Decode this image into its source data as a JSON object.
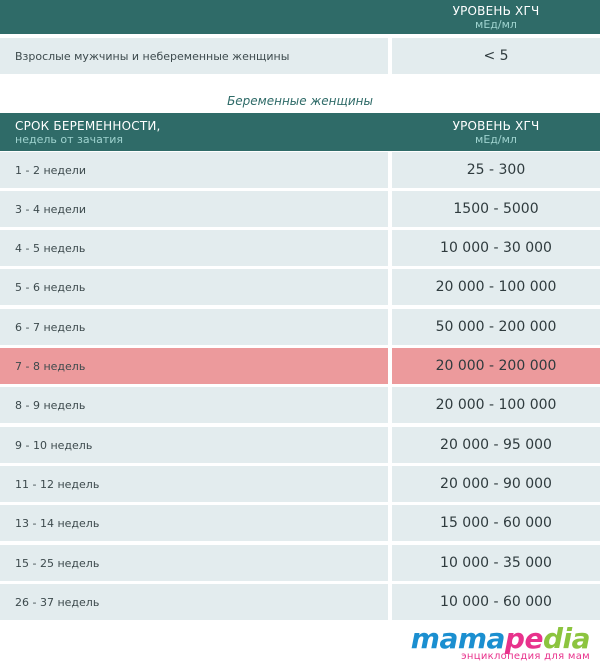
{
  "top_header": {
    "level_title": "УРОВЕНЬ ХГЧ",
    "level_unit": "мЕд/мл"
  },
  "non_pregnant": {
    "label": "Взрослые мужчины и небеременные женщины",
    "value": "< 5"
  },
  "section_title": "Беременные женщины",
  "table_header": {
    "term_title": "СРОК БЕРЕМЕННОСТИ,",
    "term_sub": "недель от зачатия",
    "level_title": "УРОВЕНЬ ХГЧ",
    "level_unit": "мЕд/мл"
  },
  "rows": [
    {
      "term": "1 - 2 недели",
      "value": "25 - 300"
    },
    {
      "term": "3 - 4 недели",
      "value": "1500 - 5000"
    },
    {
      "term": "4 - 5 недель",
      "value": "10 000 - 30 000"
    },
    {
      "term": "5 - 6 недель",
      "value": "20 000 - 100 000"
    },
    {
      "term": "6 - 7 недель",
      "value": "50 000 - 200 000"
    },
    {
      "term": "7 - 8 недель",
      "value": "20 000 - 200 000"
    },
    {
      "term": "8 - 9 недель",
      "value": "20 000 - 100 000"
    },
    {
      "term": "9 - 10 недель",
      "value": "20 000 - 95 000"
    },
    {
      "term": "11 - 12 недель",
      "value": "20 000 - 90 000"
    },
    {
      "term": "13 - 14 недель",
      "value": "15 000 - 60 000"
    },
    {
      "term": "15 - 25 недель",
      "value": "10 000 - 35 000"
    },
    {
      "term": "26 - 37 недель",
      "value": "10 000 - 60 000"
    }
  ],
  "highlighted_row": 5,
  "colors": {
    "header_bg": "#2f6b68",
    "row_bg": "#e3ecee",
    "highlight_bg": "#ec9a9c"
  },
  "logo": {
    "part1": "mama",
    "part2": "pe",
    "part3": "dia",
    "tagline": "энциклопедия для мам"
  }
}
